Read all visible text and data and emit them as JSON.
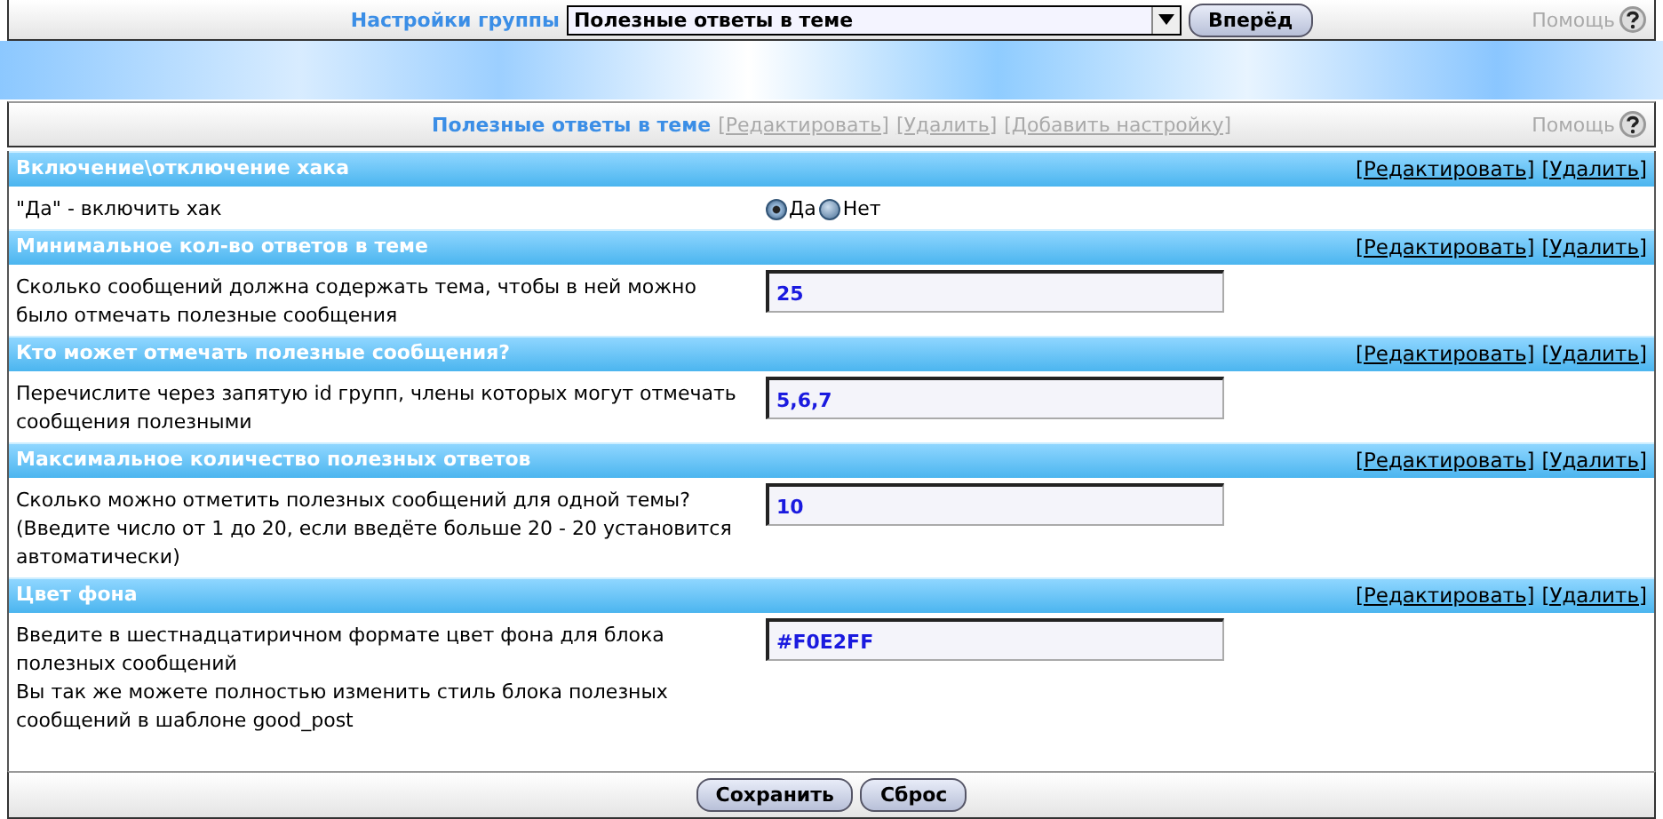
{
  "top_bar": {
    "label": "Настройки группы",
    "select_value": "Полезные ответы в теме",
    "go_button": "Вперёд",
    "help_text": "Помощь"
  },
  "group_bar": {
    "title": "Полезные ответы в теме",
    "links": [
      "[Редактировать]",
      "[Удалить]",
      "[Добавить настройку]"
    ],
    "help_text": "Помощь"
  },
  "settings": [
    {
      "title": "Включение\\отключение хака",
      "actions": [
        "[Редактировать]",
        "[Удалить]"
      ],
      "kind": "radio",
      "description": [
        "\"Да\" - включить хак"
      ],
      "options": [
        {
          "label": "Да",
          "selected": true
        },
        {
          "label": "Нет",
          "selected": false
        }
      ]
    },
    {
      "title": "Минимальное кол-во ответов в теме",
      "actions": [
        "[Редактировать]",
        "[Удалить]"
      ],
      "kind": "text",
      "description": [
        "Сколько сообщений должна содержать тема, чтобы в ней можно было отмечать полезные сообщения"
      ],
      "value": "25"
    },
    {
      "title": "Кто может отмечать полезные сообщения?",
      "actions": [
        "[Редактировать]",
        "[Удалить]"
      ],
      "kind": "text",
      "description": [
        "Перечислите через запятую id групп, члены которых могут отмечать сообщения полезными"
      ],
      "value": "5,6,7"
    },
    {
      "title": "Максимальное количество полезных ответов",
      "actions": [
        "[Редактировать]",
        "[Удалить]"
      ],
      "kind": "text",
      "description": [
        "Сколько можно отметить полезных сообщений для одной темы? (Введите число от 1 до 20, если введёте больше 20 - 20 установится автоматически)"
      ],
      "value": "10"
    },
    {
      "title": "Цвет фона",
      "actions": [
        "[Редактировать]",
        "[Удалить]"
      ],
      "kind": "text",
      "description": [
        "Введите в шестнадцатиричном формате цвет фона для блока полезных сообщений",
        "Вы так же можете полностью изменить стиль блока полезных сообщений в шаблоне good_post"
      ],
      "value": "#F0E2FF"
    }
  ],
  "footer": {
    "buttons": [
      "Сохранить",
      "Сброс"
    ]
  }
}
